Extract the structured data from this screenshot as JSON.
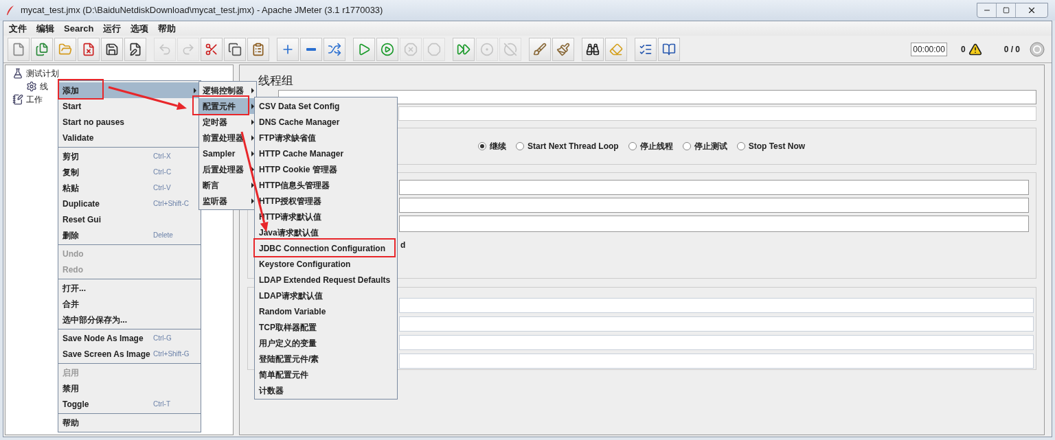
{
  "window": {
    "title": "mycat_test.jmx (D:\\BaiduNetdiskDownload\\mycat_test.jmx) - Apache JMeter (3.1 r1770033)"
  },
  "menubar": [
    "文件",
    "编辑",
    "Search",
    "运行",
    "选项",
    "帮助"
  ],
  "toolbar": {
    "buttons": [
      {
        "kind": "new",
        "disabled": false
      },
      {
        "kind": "templates",
        "disabled": false
      },
      {
        "kind": "open",
        "disabled": false
      },
      {
        "kind": "close",
        "disabled": false
      },
      {
        "kind": "save",
        "disabled": false
      },
      {
        "kind": "saveas",
        "disabled": false
      },
      {
        "kind": "undo",
        "disabled": true
      },
      {
        "kind": "redo",
        "disabled": true
      },
      {
        "kind": "cut",
        "disabled": false
      },
      {
        "kind": "copy",
        "disabled": false
      },
      {
        "kind": "paste",
        "disabled": false
      },
      {
        "kind": "expand",
        "disabled": false
      },
      {
        "kind": "collapse",
        "disabled": false
      },
      {
        "kind": "toggle",
        "disabled": false
      },
      {
        "kind": "start",
        "disabled": false
      },
      {
        "kind": "startnopause",
        "disabled": false
      },
      {
        "kind": "stop",
        "disabled": true
      },
      {
        "kind": "shutdown",
        "disabled": true
      },
      {
        "kind": "remotestart",
        "disabled": false
      },
      {
        "kind": "remotestop",
        "disabled": true
      },
      {
        "kind": "remoteshutdown",
        "disabled": true
      },
      {
        "kind": "clear",
        "disabled": false
      },
      {
        "kind": "clearall",
        "disabled": false
      },
      {
        "kind": "search",
        "disabled": false
      },
      {
        "kind": "resetsearch",
        "disabled": false
      },
      {
        "kind": "functions",
        "disabled": false
      },
      {
        "kind": "help",
        "disabled": false
      }
    ],
    "timer": "00:00:00",
    "warnings": "0",
    "threads": "0 / 0"
  },
  "tree": [
    {
      "label": "测试计划",
      "kind": "plan",
      "children": [
        {
          "label": "线",
          "kind": "group"
        }
      ]
    },
    {
      "label": "工作",
      "kind": "bench"
    }
  ],
  "panel": {
    "title": "线程组",
    "error_action": [
      {
        "label": "继续",
        "selected": true
      },
      {
        "label": "Start Next Thread Loop",
        "selected": false
      },
      {
        "label": "停止线程",
        "selected": false
      },
      {
        "label": "停止测试",
        "selected": false
      },
      {
        "label": "Stop Test Now",
        "selected": false
      }
    ],
    "label_fragment": "d"
  },
  "context_menu": [
    {
      "kind": "item",
      "label": "添加",
      "highlighted": true,
      "disabled": false,
      "submenu": true
    },
    {
      "kind": "item",
      "label": "Start",
      "highlighted": false,
      "disabled": false,
      "submenu": false
    },
    {
      "kind": "item",
      "label": "Start no pauses",
      "highlighted": false,
      "disabled": false,
      "submenu": false
    },
    {
      "kind": "item",
      "label": "Validate",
      "highlighted": false,
      "disabled": false,
      "submenu": false
    },
    {
      "kind": "separator"
    },
    {
      "kind": "item",
      "label": "剪切",
      "shortcut": "Ctrl-X",
      "highlighted": false,
      "disabled": false,
      "submenu": false
    },
    {
      "kind": "item",
      "label": "复制",
      "shortcut": "Ctrl-C",
      "highlighted": false,
      "disabled": false,
      "submenu": false
    },
    {
      "kind": "item",
      "label": "粘贴",
      "shortcut": "Ctrl-V",
      "highlighted": false,
      "disabled": false,
      "submenu": false
    },
    {
      "kind": "item",
      "label": "Duplicate",
      "shortcut": "Ctrl+Shift-C",
      "highlighted": false,
      "disabled": false,
      "submenu": false
    },
    {
      "kind": "item",
      "label": "Reset Gui",
      "highlighted": false,
      "disabled": false,
      "submenu": false
    },
    {
      "kind": "item",
      "label": "删除",
      "shortcut": "Delete",
      "highlighted": false,
      "disabled": false,
      "submenu": false
    },
    {
      "kind": "separator"
    },
    {
      "kind": "item",
      "label": "Undo",
      "highlighted": false,
      "disabled": true,
      "submenu": false
    },
    {
      "kind": "item",
      "label": "Redo",
      "highlighted": false,
      "disabled": true,
      "submenu": false
    },
    {
      "kind": "separator"
    },
    {
      "kind": "item",
      "label": "打开...",
      "highlighted": false,
      "disabled": false,
      "submenu": false
    },
    {
      "kind": "item",
      "label": "合并",
      "highlighted": false,
      "disabled": false,
      "submenu": false
    },
    {
      "kind": "item",
      "label": "选中部分保存为...",
      "highlighted": false,
      "disabled": false,
      "submenu": false
    },
    {
      "kind": "separator"
    },
    {
      "kind": "item",
      "label": "Save Node As Image",
      "shortcut": "Ctrl-G",
      "highlighted": false,
      "disabled": false,
      "submenu": false
    },
    {
      "kind": "item",
      "label": "Save Screen As Image",
      "shortcut": "Ctrl+Shift-G",
      "highlighted": false,
      "disabled": false,
      "submenu": false
    },
    {
      "kind": "separator"
    },
    {
      "kind": "item",
      "label": "启用",
      "highlighted": false,
      "disabled": true,
      "submenu": false
    },
    {
      "kind": "item",
      "label": "禁用",
      "highlighted": false,
      "disabled": false,
      "submenu": false
    },
    {
      "kind": "item",
      "label": "Toggle",
      "shortcut": "Ctrl-T",
      "highlighted": false,
      "disabled": false,
      "submenu": false
    },
    {
      "kind": "separator"
    },
    {
      "kind": "item",
      "label": "帮助",
      "highlighted": false,
      "disabled": false,
      "submenu": false
    }
  ],
  "add_submenu": [
    {
      "label": "逻辑控制器",
      "highlighted": false
    },
    {
      "label": "配置元件",
      "highlighted": true
    },
    {
      "label": "定时器",
      "highlighted": false
    },
    {
      "label": "前置处理器",
      "highlighted": false
    },
    {
      "label": "Sampler",
      "highlighted": false
    },
    {
      "label": "后置处理器",
      "highlighted": false
    },
    {
      "label": "断言",
      "highlighted": false
    },
    {
      "label": "监听器",
      "highlighted": false
    }
  ],
  "config_submenu": [
    "CSV Data Set Config",
    "DNS Cache Manager",
    "FTP请求缺省值",
    "HTTP Cache Manager",
    "HTTP Cookie 管理器",
    "HTTP信息头管理器",
    "HTTP授权管理器",
    "HTTP请求默认值",
    "Java请求默认值",
    "JDBC Connection Configuration",
    "Keystore Configuration",
    "LDAP Extended Request Defaults",
    "LDAP请求默认值",
    "Random Variable",
    "TCP取样器配置",
    "用户定义的变量",
    "登陆配置元件/素",
    "简单配置元件",
    "计数器"
  ]
}
